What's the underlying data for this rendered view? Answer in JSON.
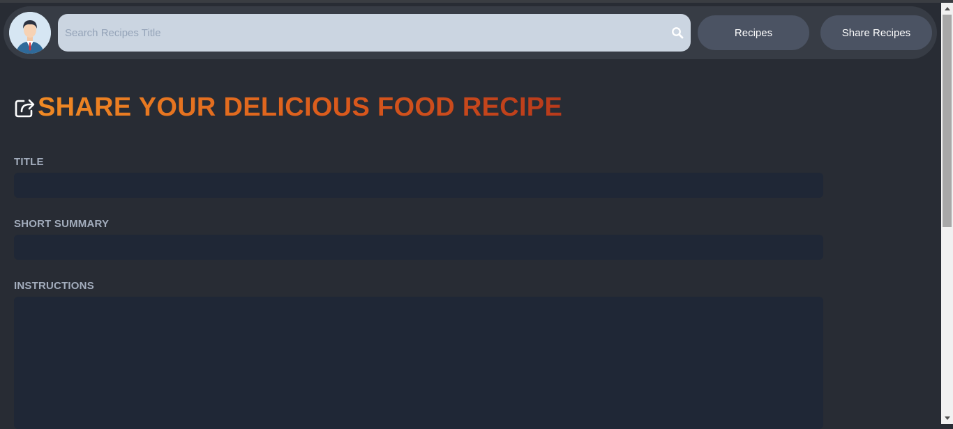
{
  "navbar": {
    "avatar_icon": "user-avatar-icon",
    "search": {
      "placeholder": "Search Recipes Title",
      "value": "",
      "icon": "search-icon"
    },
    "buttons": {
      "recipes": "Recipes",
      "share_recipes": "Share Recipes"
    }
  },
  "main": {
    "heading": {
      "icon": "share-icon",
      "text": "SHARE YOUR DELICIOUS FOOD RECIPE"
    },
    "form": {
      "title_label": "TITLE",
      "title_value": "",
      "summary_label": "SHORT SUMMARY",
      "summary_value": "",
      "instructions_label": "INSTRUCTIONS",
      "instructions_value": ""
    }
  },
  "colors": {
    "background": "#282c34",
    "navbar": "#373c45",
    "search_bg": "#cbd5e1",
    "button_bg": "#4b5363",
    "field_bg": "#1f2736",
    "label": "#a3adbd",
    "heading_gradient": [
      "#f08a24",
      "#b83a1b"
    ]
  }
}
